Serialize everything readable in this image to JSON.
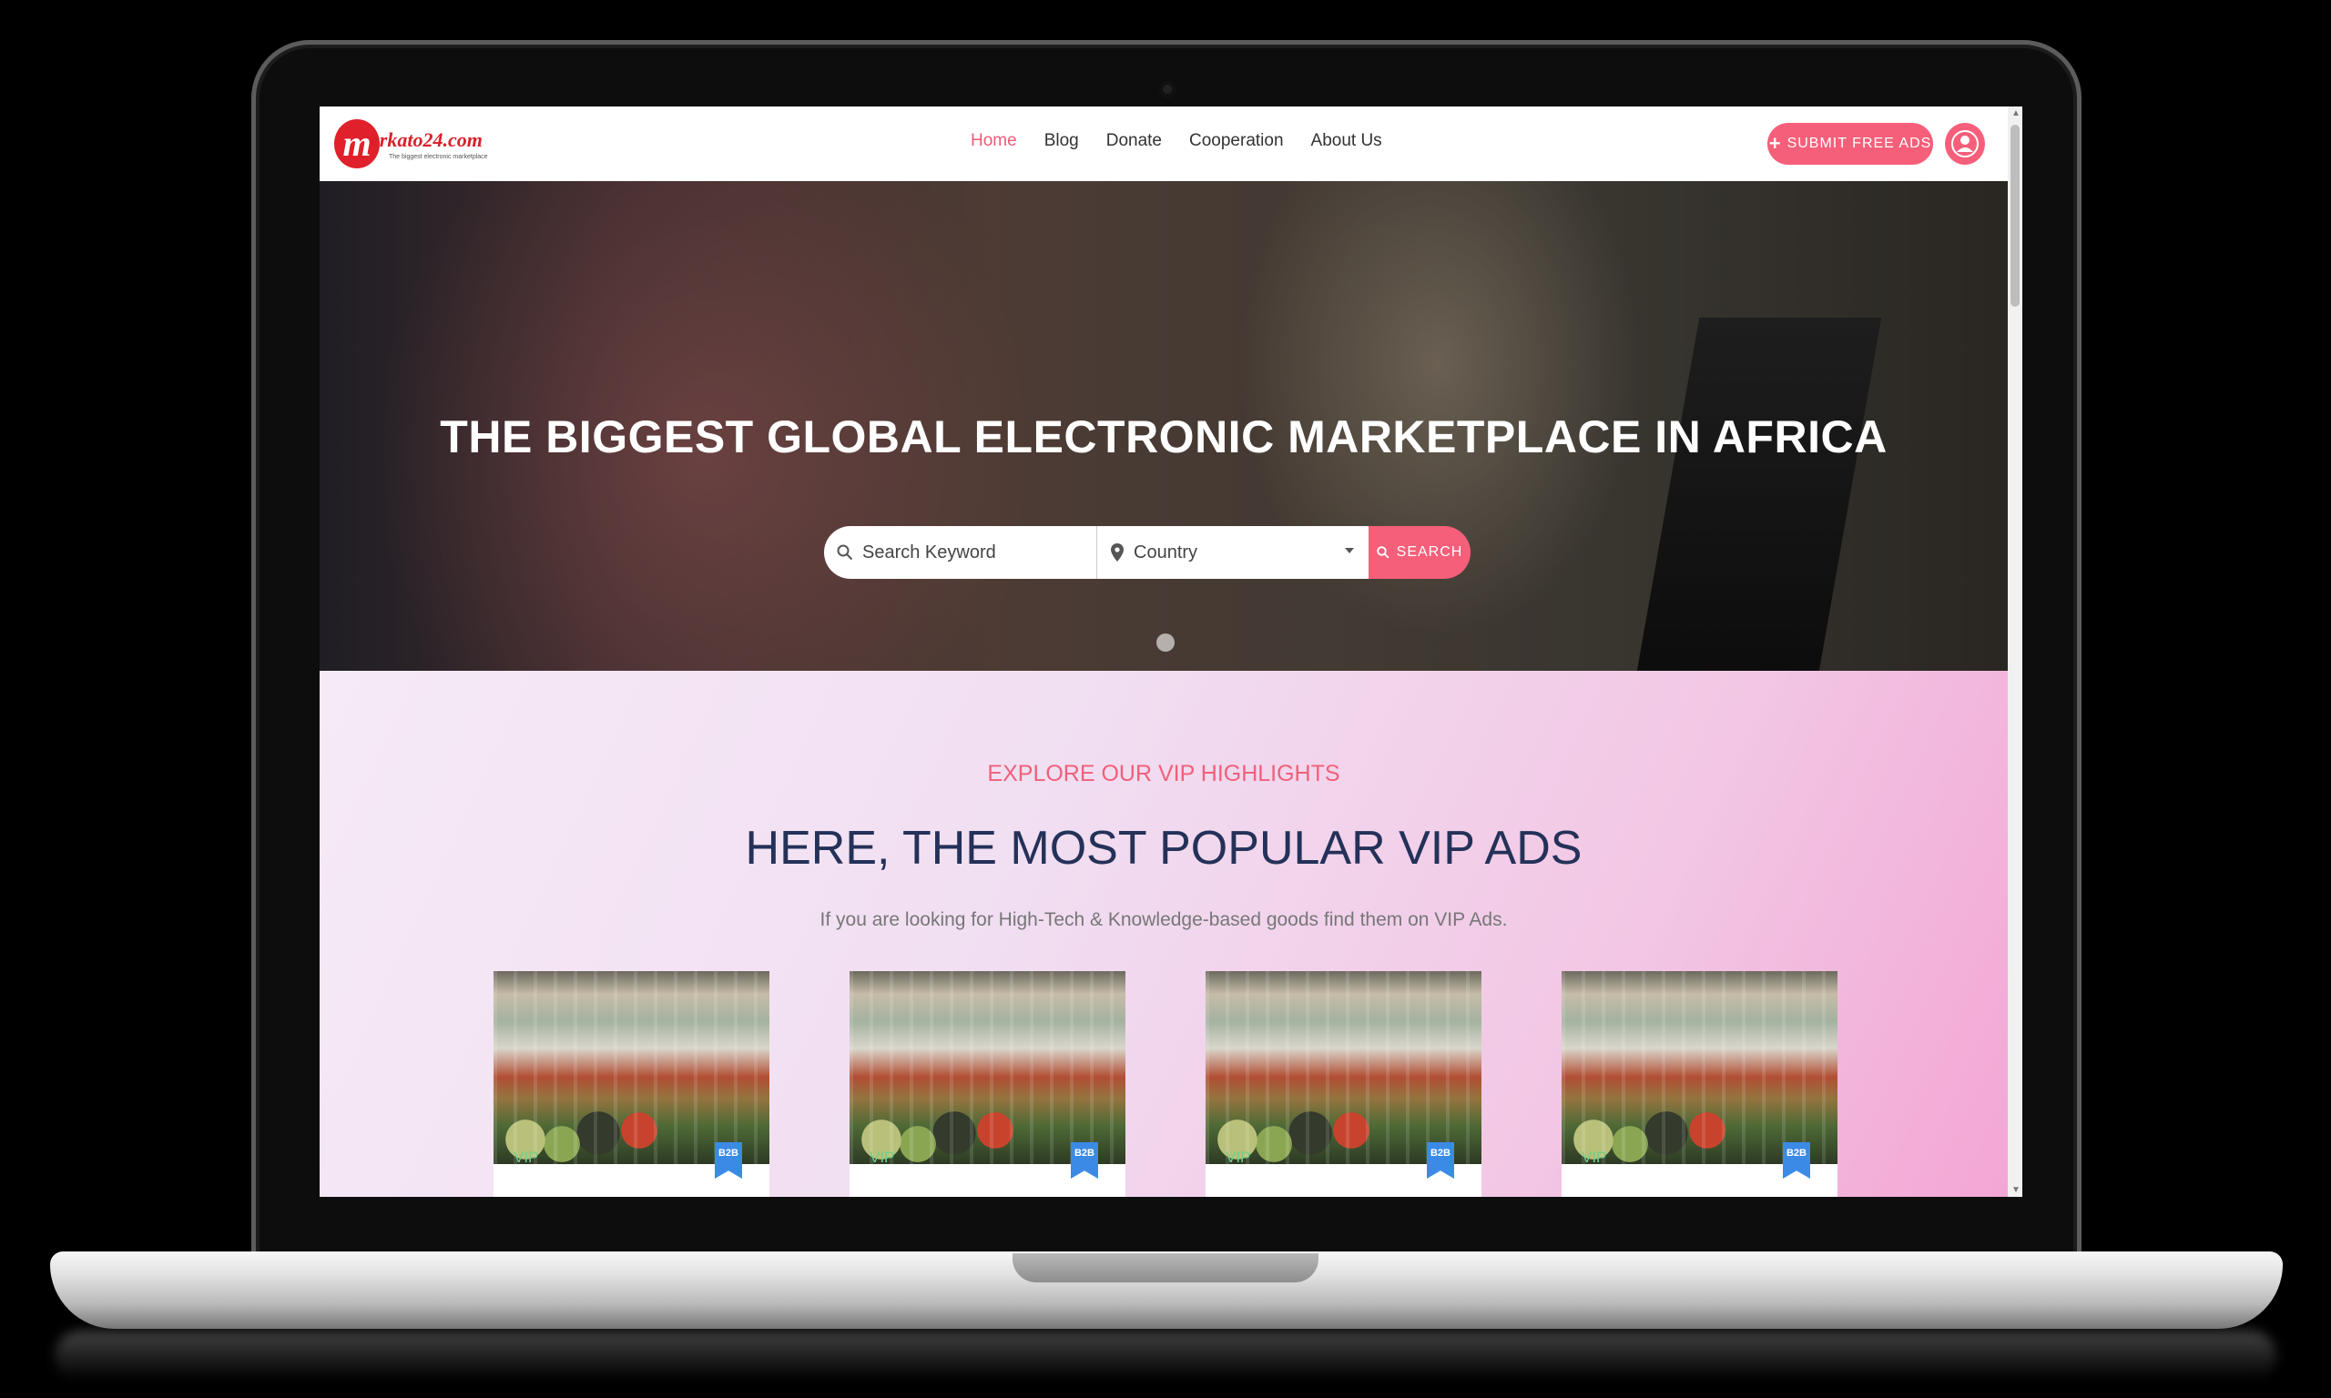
{
  "brand": {
    "logo_letter": "m",
    "logo_text": "erkato24.com",
    "tagline": "The biggest electronic marketplace"
  },
  "nav": {
    "links": [
      "Home",
      "Blog",
      "Donate",
      "Cooperation",
      "About Us"
    ],
    "active": "Home",
    "submit_label": "SUBMIT FREE ADS"
  },
  "hero": {
    "title": "THE BIGGEST GLOBAL ELECTRONIC MARKETPLACE IN AFRICA",
    "search_placeholder": "Search Keyword",
    "country_placeholder": "Country",
    "search_button": "SEARCH"
  },
  "vip": {
    "label": "EXPLORE OUR VIP HIGHLIGHTS",
    "heading": "HERE, THE MOST POPULAR VIP ADS",
    "description": "If you are looking for High-Tech & Knowledge-based goods find them on VIP Ads.",
    "cards": [
      {
        "badge": "VIP",
        "tag": "B2B"
      },
      {
        "badge": "VIP",
        "tag": "B2B"
      },
      {
        "badge": "VIP",
        "tag": "B2B"
      },
      {
        "badge": "VIP",
        "tag": "B2B"
      }
    ]
  },
  "colors": {
    "accent": "#f55f7a",
    "heading": "#243158",
    "tag_blue": "#3b8be6",
    "vip_green": "#6ed08a"
  },
  "icons": [
    "search-icon",
    "map-pin-icon",
    "user-icon",
    "plus-icon",
    "dropdown-caret-icon"
  ]
}
